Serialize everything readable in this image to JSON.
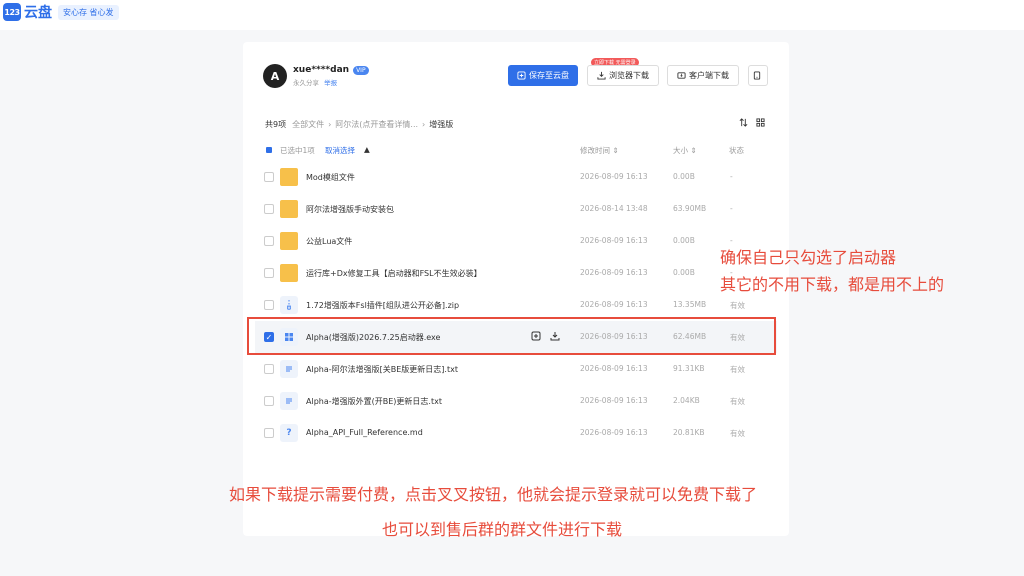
{
  "app": {
    "logo_mark": "123",
    "logo_text": "云盘",
    "slogan": "安心存 省心发"
  },
  "user": {
    "avatar": "A",
    "name": "xue****dan",
    "vip": "VIP",
    "share_type": "永久分享",
    "report": "举报"
  },
  "buttons": {
    "save": "保存至云盘",
    "browser": "浏览器下载",
    "browser_badge": "立即下载 无需登录",
    "client": "客户端下载"
  },
  "breadcrumb": {
    "count": "共9项",
    "items": [
      "全部文件",
      "阿尔法(点开查看详情...",
      "增强版"
    ]
  },
  "table": {
    "selected_text": "已选中1项",
    "cancel_text": "取消选择",
    "sort_glyph": "▲",
    "columns": {
      "time": "修改时间",
      "size": "大小",
      "status": "状态"
    },
    "rows": [
      {
        "name": "Mod模组文件",
        "time": "2026-08-09 16:13",
        "size": "0.00B",
        "status": "-"
      },
      {
        "name": "阿尔法增强版手动安装包",
        "time": "2026-08-14 13:48",
        "size": "63.90MB",
        "status": "-"
      },
      {
        "name": "公益Lua文件",
        "time": "2026-08-09 16:13",
        "size": "0.00B",
        "status": "-"
      },
      {
        "name": "运行库+Dx修复工具【启动器和FSL不生效必装】",
        "time": "2026-08-09 16:13",
        "size": "0.00B",
        "status": "-"
      },
      {
        "name": "1.72增强版本Fsl插件[组队进公开必备].zip",
        "time": "2026-08-09 16:13",
        "size": "13.35MB",
        "status": "有效"
      },
      {
        "name": "Alpha(增强版)2026.7.25启动器.exe",
        "time": "2026-08-09 16:13",
        "size": "62.46MB",
        "status": "有效"
      },
      {
        "name": "Alpha-阿尔法增强版[关BE版更新日志].txt",
        "time": "2026-08-09 16:13",
        "size": "91.31KB",
        "status": "有效"
      },
      {
        "name": "Alpha-增强版外置(开BE)更新日志.txt",
        "time": "2026-08-09 16:13",
        "size": "2.04KB",
        "status": "有效"
      },
      {
        "name": "Alpha_API_Full_Reference.md",
        "time": "2026-08-09 16:13",
        "size": "20.81KB",
        "status": "有效"
      }
    ]
  },
  "annotations": {
    "right_line1": "确保自己只勾选了启动器",
    "right_line2": "其它的不用下载，都是用不上的",
    "bottom_line1": "如果下载提示需要付费，点击叉叉按钮，他就会提示登录就可以免费下载了",
    "bottom_line2": "也可以到售后群的群文件进行下载"
  },
  "colors": {
    "accent": "#2f6fe8",
    "annotation": "#e74c3c",
    "folder": "#f7c04a"
  }
}
